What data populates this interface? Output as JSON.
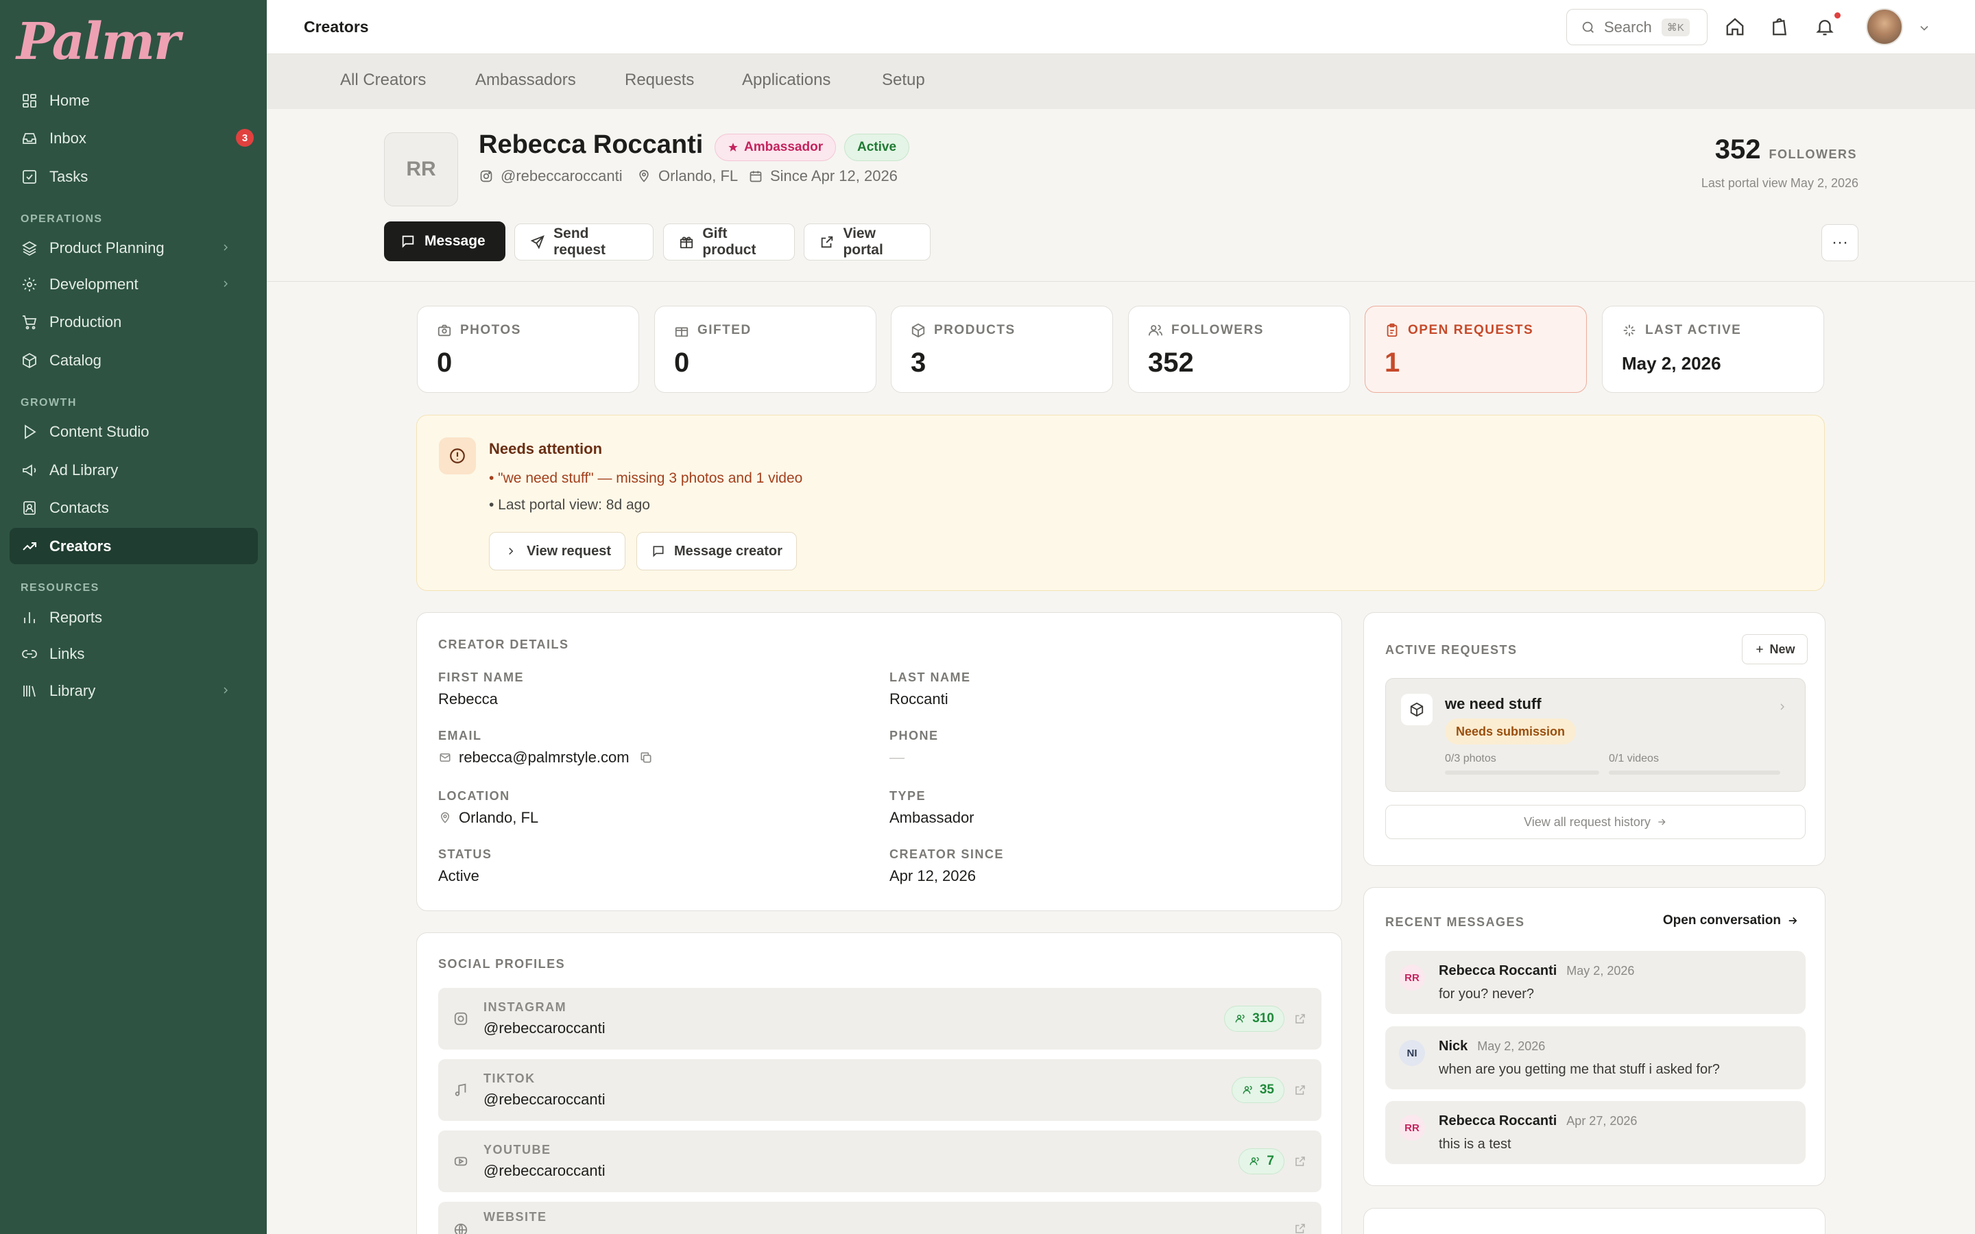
{
  "app": {
    "logo": "Palmr"
  },
  "sidebar": {
    "items": [
      {
        "label": "Home",
        "icon": "grid-icon"
      },
      {
        "label": "Inbox",
        "icon": "inbox-icon",
        "badge": "3"
      },
      {
        "label": "Tasks",
        "icon": "checkbox-icon"
      }
    ],
    "sections": [
      {
        "label": "OPERATIONS"
      },
      {
        "label": "GROWTH"
      },
      {
        "label": "RESOURCES"
      }
    ],
    "operations": [
      {
        "label": "Product Planning",
        "icon": "layers-icon"
      },
      {
        "label": "Development",
        "icon": "gear-icon"
      },
      {
        "label": "Production",
        "icon": "cart-icon"
      },
      {
        "label": "Catalog",
        "icon": "box-icon"
      }
    ],
    "growth": [
      {
        "label": "Content Studio",
        "icon": "play-icon"
      },
      {
        "label": "Ad Library",
        "icon": "megaphone-icon"
      },
      {
        "label": "Contacts",
        "icon": "contact-icon"
      },
      {
        "label": "Creators",
        "icon": "trend-icon"
      }
    ],
    "resources": [
      {
        "label": "Reports",
        "icon": "bar-chart-icon"
      },
      {
        "label": "Links",
        "icon": "link-icon"
      },
      {
        "label": "Library",
        "icon": "library-icon"
      }
    ]
  },
  "header": {
    "title": "Creators",
    "search_placeholder": "Search",
    "search_shortcut": "⌘K"
  },
  "tabs": [
    "All Creators",
    "Ambassadors",
    "Requests",
    "Applications",
    "Setup"
  ],
  "profile": {
    "initials": "RR",
    "name": "Rebecca Roccanti",
    "badge_ambassador": "Ambassador",
    "badge_status": "Active",
    "handle": "@rebeccaroccanti",
    "location": "Orlando, FL",
    "since": "Since Apr 12, 2026",
    "followers_count": "352",
    "followers_label": "FOLLOWERS",
    "last_portal_view": "Last portal view May 2, 2026"
  },
  "actions": {
    "message": "Message",
    "send_request": "Send request",
    "gift_product": "Gift product",
    "view_portal": "View portal",
    "more": "···"
  },
  "stats": [
    {
      "label": "PHOTOS",
      "value": "0",
      "icon": "camera-icon"
    },
    {
      "label": "GIFTED",
      "value": "0",
      "icon": "gift-icon"
    },
    {
      "label": "PRODUCTS",
      "value": "3",
      "icon": "box-icon"
    },
    {
      "label": "FOLLOWERS",
      "value": "352",
      "icon": "users-icon"
    },
    {
      "label": "OPEN REQUESTS",
      "value": "1",
      "icon": "clipboard-icon"
    },
    {
      "label": "LAST ACTIVE",
      "value": "May 2, 2026",
      "icon": "sparkle-icon"
    }
  ],
  "attention": {
    "title": "Needs attention",
    "line1": "• \"we need stuff\" — missing 3 photos and 1 video",
    "line2": "• Last portal view: 8d ago",
    "view_request": "View request",
    "message_creator": "Message creator"
  },
  "details": {
    "title": "CREATOR DETAILS",
    "first_name_label": "FIRST NAME",
    "first_name": "Rebecca",
    "last_name_label": "LAST NAME",
    "last_name": "Roccanti",
    "email_label": "EMAIL",
    "email": "rebecca@palmrstyle.com",
    "phone_label": "PHONE",
    "phone": "—",
    "location_label": "LOCATION",
    "location": "Orlando, FL",
    "type_label": "TYPE",
    "type": "Ambassador",
    "status_label": "STATUS",
    "status": "Active",
    "since_label": "CREATOR SINCE",
    "since": "Apr 12, 2026"
  },
  "social": {
    "title": "SOCIAL PROFILES",
    "profiles": [
      {
        "network": "INSTAGRAM",
        "handle": "@rebeccaroccanti",
        "count": "310"
      },
      {
        "network": "TIKTOK",
        "handle": "@rebeccaroccanti",
        "count": "35"
      },
      {
        "network": "YOUTUBE",
        "handle": "@rebeccaroccanti",
        "count": "7"
      },
      {
        "network": "WEBSITE",
        "handle": "",
        "count": ""
      }
    ]
  },
  "requests": {
    "title": "ACTIVE REQUESTS",
    "new_label": "New",
    "item": {
      "name": "we need stuff",
      "status": "Needs submission",
      "photos": "0/3 photos",
      "videos": "0/1 videos",
      "photos_progress": 0,
      "videos_progress": 0
    },
    "history": "View all request history"
  },
  "messages": {
    "title": "RECENT MESSAGES",
    "open_label": "Open conversation",
    "items": [
      {
        "initials": "RR",
        "name": "Rebecca Roccanti",
        "date": "May 2, 2026",
        "text": "for you? never?"
      },
      {
        "initials": "NI",
        "name": "Nick",
        "date": "May 2, 2026",
        "text": "when are you getting me that stuff i asked for?"
      },
      {
        "initials": "RR",
        "name": "Rebecca Roccanti",
        "date": "Apr 27, 2026",
        "text": "this is a test"
      }
    ]
  },
  "colors": {
    "sidebar_bg": "#2e5343",
    "logo": "#eea1b3",
    "accent_alert": "#c64a2a",
    "ambassador_pink": "#c4245e",
    "active_green": "#1f7a33"
  }
}
